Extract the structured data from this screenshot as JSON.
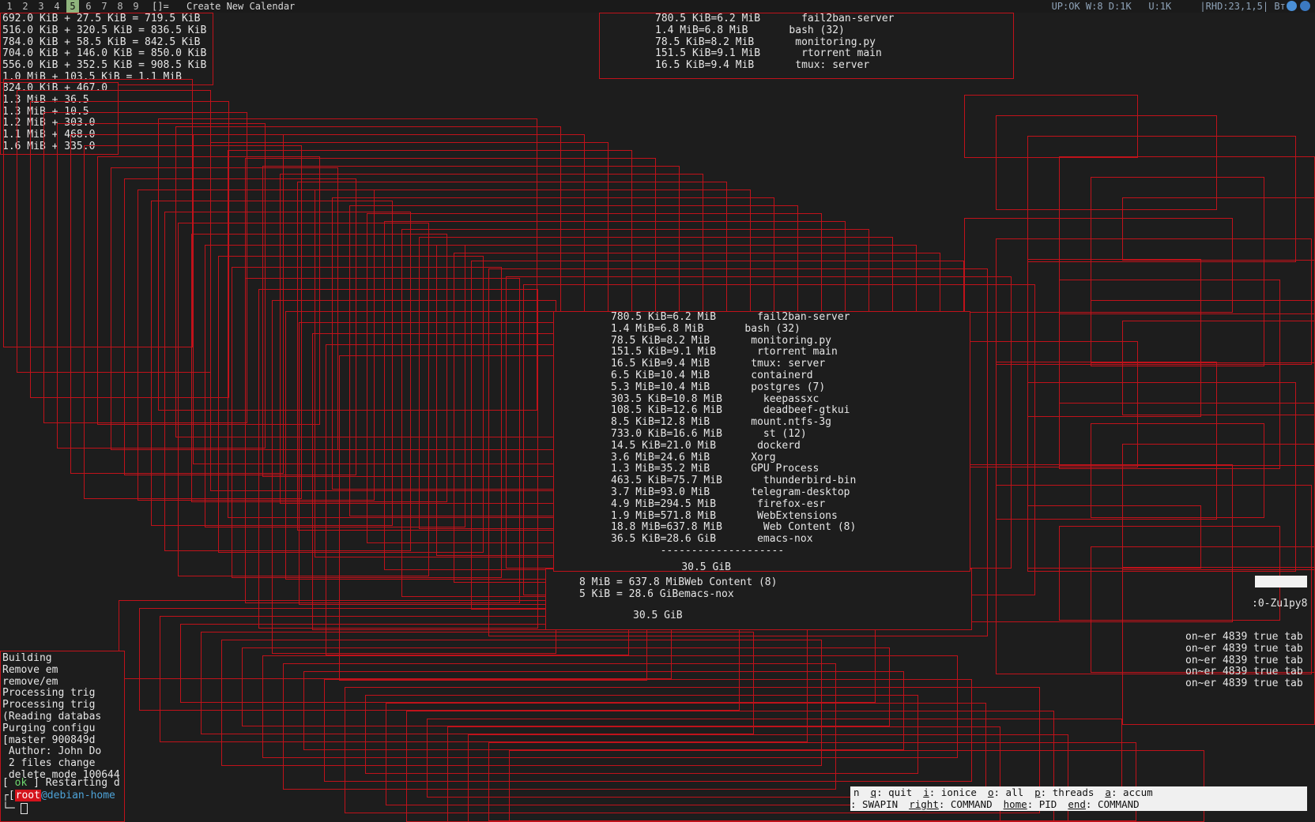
{
  "top_bar": {
    "workspaces": [
      "1",
      "2",
      "3",
      "4",
      "5",
      "6",
      "7",
      "8",
      "9"
    ],
    "active_workspace": "5",
    "layout_indicator": "[]=",
    "window_title": "Create New Calendar",
    "status": "UP:OK W:8 D:1K   U:1K     |RHD:23,1,5| Вт."
  },
  "main_process_list": {
    "rows": [
      {
        "swap": "780.5 KiB",
        "sep": "=",
        "total": "6.2 MiB",
        "command": "fail2ban-server"
      },
      {
        "swap": "1.4 MiB",
        "sep": "=",
        "total": "6.8 MiB",
        "command": "bash (32)"
      },
      {
        "swap": "78.5 KiB",
        "sep": "=",
        "total": "8.2 MiB",
        "command": "monitoring.py"
      },
      {
        "swap": "151.5 KiB",
        "sep": "=",
        "total": "9.1 MiB",
        "command": "rtorrent main"
      },
      {
        "swap": "16.5 KiB",
        "sep": "=",
        "total": "9.4 MiB",
        "command": "tmux: server"
      },
      {
        "swap": "6.5 KiB",
        "sep": "=",
        "total": "10.4 MiB",
        "command": "containerd"
      },
      {
        "swap": "5.3 MiB",
        "sep": "=",
        "total": "10.4 MiB",
        "command": "postgres (7)"
      },
      {
        "swap": "303.5 KiB",
        "sep": "=",
        "total": "10.8 MiB",
        "command": "keepassxc"
      },
      {
        "swap": "108.5 KiB",
        "sep": "=",
        "total": "12.6 MiB",
        "command": "deadbeef-gtkui"
      },
      {
        "swap": "8.5 KiB",
        "sep": "=",
        "total": "12.8 MiB",
        "command": "mount.ntfs-3g"
      },
      {
        "swap": "733.0 KiB",
        "sep": "=",
        "total": "16.6 MiB",
        "command": "st (12)"
      },
      {
        "swap": "14.5 KiB",
        "sep": "=",
        "total": "21.0 MiB",
        "command": "dockerd"
      },
      {
        "swap": "3.6 MiB",
        "sep": "=",
        "total": "24.6 MiB",
        "command": "Xorg"
      },
      {
        "swap": "1.3 MiB",
        "sep": "=",
        "total": "35.2 MiB",
        "command": "GPU Process"
      },
      {
        "swap": "463.5 KiB",
        "sep": "=",
        "total": "75.7 MiB",
        "command": "thunderbird-bin"
      },
      {
        "swap": "3.7 MiB",
        "sep": "=",
        "total": "93.0 MiB",
        "command": "telegram-desktop"
      },
      {
        "swap": "4.9 MiB",
        "sep": "=",
        "total": "294.5 MiB",
        "command": "firefox-esr"
      },
      {
        "swap": "1.9 MiB",
        "sep": "=",
        "total": "571.8 MiB",
        "command": "WebExtensions"
      },
      {
        "swap": "18.8 MiB",
        "sep": "=",
        "total": "637.8 MiB",
        "command": "Web Content (8)"
      },
      {
        "swap": "36.5 KiB",
        "sep": "=",
        "total": "28.6 GiB",
        "command": "emacs-nox"
      }
    ],
    "divider": "--------------------",
    "grand_total": "30.5 GiB"
  },
  "top_left_rows": [
    "692.0 KiB + 27.5 KiB = 719.5 KiB",
    "516.0 KiB + 320.5 KiB = 836.5 KiB",
    "784.0 KiB + 58.5 KiB = 842.5 KiB",
    "704.0 KiB + 146.0 KiB = 850.0 KiB",
    "556.0 KiB + 352.5 KiB = 908.5 KiB",
    "1.0 MiB + 103.5 KiB = 1.1 MiB"
  ],
  "second_left_rows": [
    "824.0 KiB + 467.0",
    "1.3 MiB + 36.5",
    "1.3 MiB + 10.5",
    "1.2 MiB + 303.0",
    "1.1 MiB + 468.0",
    "1.6 MiB + 335.0"
  ],
  "tail_rows": [
    {
      "total": "8 MiB = 637.8 MiB",
      "command": "Web Content (8)"
    },
    {
      "total": "5 KiB = 28.6 GiB",
      "command": "emacs-nox"
    }
  ],
  "tail_total": "30.5 GiB",
  "right_rows": [
    "4839 true tab",
    "4839 true tab",
    "4839 true tab",
    "4839 true tab",
    "4839 true tab"
  ],
  "right_frag": ":0-Zu1py8",
  "terminal": {
    "lines": [
      "Building",
      "Remove em",
      "remove/em",
      "Processing trig",
      "Processing trig",
      "(Reading databas",
      "Purging configu",
      "[master 900849d",
      " Author: John Do",
      " 2 files change",
      " delete mode 100644"
    ],
    "ok_tag": "ok",
    "restart_text": "Restarting d",
    "prompt_user": "root",
    "prompt_host": "@debian-home"
  },
  "help_bar": {
    "line1": [
      {
        "key": "q",
        "label": ": quit"
      },
      {
        "key": "i",
        "label": ": ionice"
      },
      {
        "key": "o",
        "label": ": all"
      },
      {
        "key": "p",
        "label": ": threads"
      },
      {
        "key": "a",
        "label": ": accum"
      }
    ],
    "line1_prefix": "n",
    "line2_prefix": ": SWAPIN",
    "line2": [
      {
        "key": "right",
        "label": ": COMMAND"
      },
      {
        "key": "home",
        "label": ": PID"
      },
      {
        "key": "end",
        "label": ": COMMAND"
      }
    ]
  },
  "colors": {
    "border": "#c0121a",
    "background": "#1d1d1d",
    "active_ws": "#8fb47d",
    "ok": "#6fd86f",
    "root": "#d4131c",
    "host": "#4da3d8"
  }
}
